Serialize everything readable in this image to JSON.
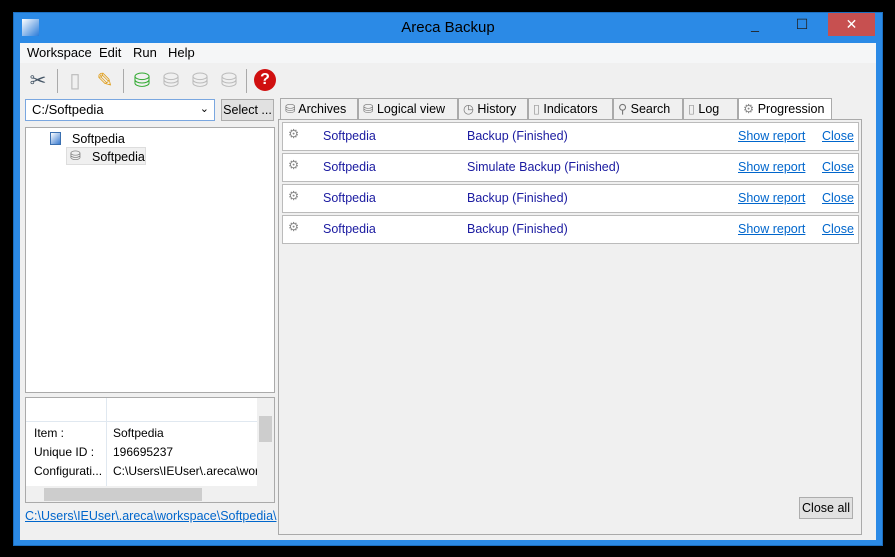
{
  "window": {
    "title": "Areca Backup",
    "minimize": "_",
    "maximize": "☐",
    "close": "✕"
  },
  "menu": [
    "Workspace",
    "Edit",
    "Run",
    "Help"
  ],
  "toolbar": {
    "icons": [
      "tools-icon",
      "new-file-icon",
      "edit-icon",
      "add-target-icon",
      "backup-icon",
      "merge-icon",
      "restore-icon",
      "help-icon"
    ]
  },
  "workspace": {
    "path": "C:/Softpedia",
    "select_label": "Select ..."
  },
  "tree": {
    "root": "Softpedia",
    "child": "Softpedia"
  },
  "properties": [
    {
      "label": "Item :",
      "value": "Softpedia"
    },
    {
      "label": "Unique ID :",
      "value": "196695237"
    },
    {
      "label": "Configurati...",
      "value": "C:\\Users\\IEUser\\.areca\\wor"
    }
  ],
  "footer_path": "C:\\Users\\IEUser\\.areca\\workspace\\Softpedia\\",
  "tabs": [
    "Archives",
    "Logical view",
    "History",
    "Indicators",
    "Search",
    "Log",
    "Progression"
  ],
  "active_tab": "Progression",
  "tasks": [
    {
      "target": "Softpedia",
      "status": "Backup (Finished)",
      "report": "Show report",
      "close": "Close"
    },
    {
      "target": "Softpedia",
      "status": "Simulate Backup (Finished)",
      "report": "Show report",
      "close": "Close"
    },
    {
      "target": "Softpedia",
      "status": "Backup (Finished)",
      "report": "Show report",
      "close": "Close"
    },
    {
      "target": "Softpedia",
      "status": "Backup (Finished)",
      "report": "Show report",
      "close": "Close"
    }
  ],
  "close_all": "Close all"
}
